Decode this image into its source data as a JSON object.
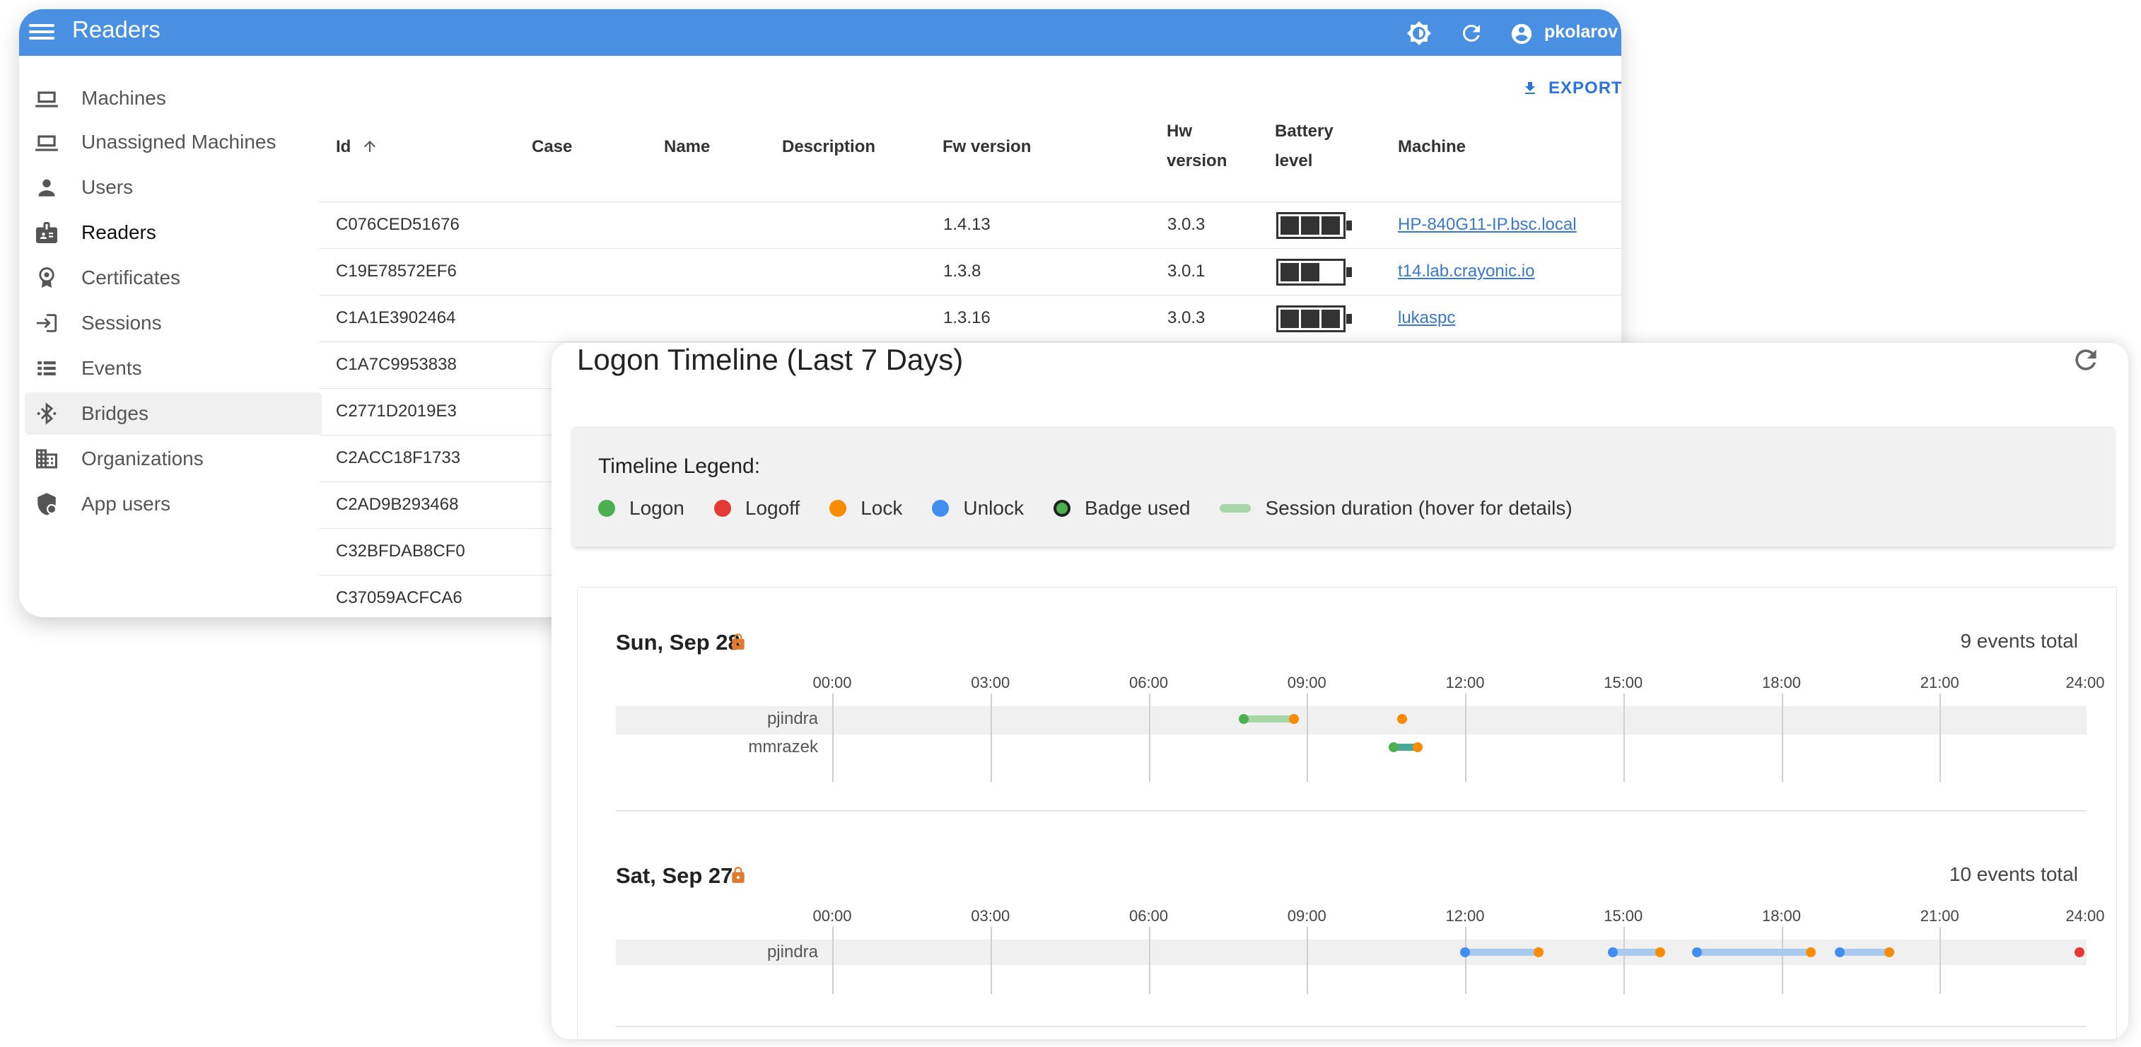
{
  "app": {
    "title": "Readers",
    "user": "pkolarov",
    "export_label": "EXPORT"
  },
  "sidebar": {
    "items": [
      {
        "label": "Machines",
        "icon": "laptop-icon"
      },
      {
        "label": "Unassigned Machines",
        "icon": "laptop-icon"
      },
      {
        "label": "Users",
        "icon": "person-icon"
      },
      {
        "label": "Readers",
        "icon": "badge-icon"
      },
      {
        "label": "Certificates",
        "icon": "certificate-icon"
      },
      {
        "label": "Sessions",
        "icon": "login-icon"
      },
      {
        "label": "Events",
        "icon": "list-icon"
      },
      {
        "label": "Bridges",
        "icon": "bluetooth-icon"
      },
      {
        "label": "Organizations",
        "icon": "building-icon"
      },
      {
        "label": "App users",
        "icon": "shield-user-icon"
      }
    ]
  },
  "table": {
    "headers": {
      "id": "Id",
      "case": "Case",
      "name": "Name",
      "description": "Description",
      "fw": "Fw version",
      "hw_line1": "Hw",
      "hw_line2": "version",
      "battery_line1": "Battery",
      "battery_line2": "level",
      "machine": "Machine"
    },
    "rows": [
      {
        "id": "C076CED51676",
        "fw": "1.4.13",
        "hw": "3.0.3",
        "battery": 3,
        "machine": "HP-840G11-IP.bsc.local"
      },
      {
        "id": "C19E78572EF6",
        "fw": "1.3.8",
        "hw": "3.0.1",
        "battery": 2,
        "machine": "t14.lab.crayonic.io"
      },
      {
        "id": "C1A1E3902464",
        "fw": "1.3.16",
        "hw": "3.0.3",
        "battery": 3,
        "machine": "lukaspc"
      },
      {
        "id": "C1A7C9953838"
      },
      {
        "id": "C2771D2019E3"
      },
      {
        "id": "C2ACC18F1733"
      },
      {
        "id": "C2AD9B293468"
      },
      {
        "id": "C32BFDAB8CF0"
      },
      {
        "id": "C37059ACFCA6"
      }
    ]
  },
  "timeline": {
    "title": "Logon Timeline (Last 7 Days)",
    "legend_title": "Timeline Legend:",
    "legend": [
      {
        "label": "Logon",
        "color": "#4caf50",
        "kind": "dot"
      },
      {
        "label": "Logoff",
        "color": "#e53935",
        "kind": "dot"
      },
      {
        "label": "Lock",
        "color": "#fb8c00",
        "kind": "dot"
      },
      {
        "label": "Unlock",
        "color": "#3f8ef0",
        "kind": "dot"
      },
      {
        "label": "Badge used",
        "color": "#4caf50",
        "kind": "ring"
      },
      {
        "label": "Session duration (hover for details)",
        "color": "#a9d6a9",
        "kind": "bar"
      }
    ],
    "ticks": [
      "00:00",
      "03:00",
      "06:00",
      "09:00",
      "12:00",
      "15:00",
      "18:00",
      "21:00",
      "24:00"
    ],
    "days": [
      {
        "title": "Sun, Sep 28",
        "count": "9 events total",
        "users": [
          "pjindra",
          "mmrazek"
        ],
        "sessions": [
          {
            "user": 0,
            "start": 7.8,
            "end": 8.75,
            "color": "#a9d6a9"
          },
          {
            "user": 1,
            "start": 10.65,
            "end": 11.15,
            "color": "#4aa89a"
          }
        ],
        "events": [
          {
            "user": 0,
            "t": 7.8,
            "color": "#4caf50"
          },
          {
            "user": 0,
            "t": 8.75,
            "color": "#fb8c00"
          },
          {
            "user": 0,
            "t": 10.8,
            "color": "#fb8c00"
          },
          {
            "user": 1,
            "t": 10.65,
            "color": "#4caf50"
          },
          {
            "user": 1,
            "t": 11.1,
            "color": "#fb8c00"
          }
        ]
      },
      {
        "title": "Sat, Sep 27",
        "count": "10 events total",
        "users": [
          "pjindra"
        ],
        "sessions": [
          {
            "user": 0,
            "start": 12.0,
            "end": 13.4,
            "color": "#a9c9ef"
          },
          {
            "user": 0,
            "start": 14.8,
            "end": 15.7,
            "color": "#a9c9ef"
          },
          {
            "user": 0,
            "start": 16.4,
            "end": 18.55,
            "color": "#a9c9ef"
          },
          {
            "user": 0,
            "start": 19.1,
            "end": 20.05,
            "color": "#a9c9ef"
          }
        ],
        "events": [
          {
            "user": 0,
            "t": 12.0,
            "color": "#3f8ef0"
          },
          {
            "user": 0,
            "t": 13.4,
            "color": "#fb8c00"
          },
          {
            "user": 0,
            "t": 14.8,
            "color": "#3f8ef0"
          },
          {
            "user": 0,
            "t": 15.7,
            "color": "#fb8c00"
          },
          {
            "user": 0,
            "t": 16.4,
            "color": "#3f8ef0"
          },
          {
            "user": 0,
            "t": 18.55,
            "color": "#fb8c00"
          },
          {
            "user": 0,
            "t": 19.1,
            "color": "#3f8ef0"
          },
          {
            "user": 0,
            "t": 20.05,
            "color": "#fb8c00"
          },
          {
            "user": 0,
            "t": 23.65,
            "color": "#e53935"
          }
        ]
      }
    ]
  }
}
